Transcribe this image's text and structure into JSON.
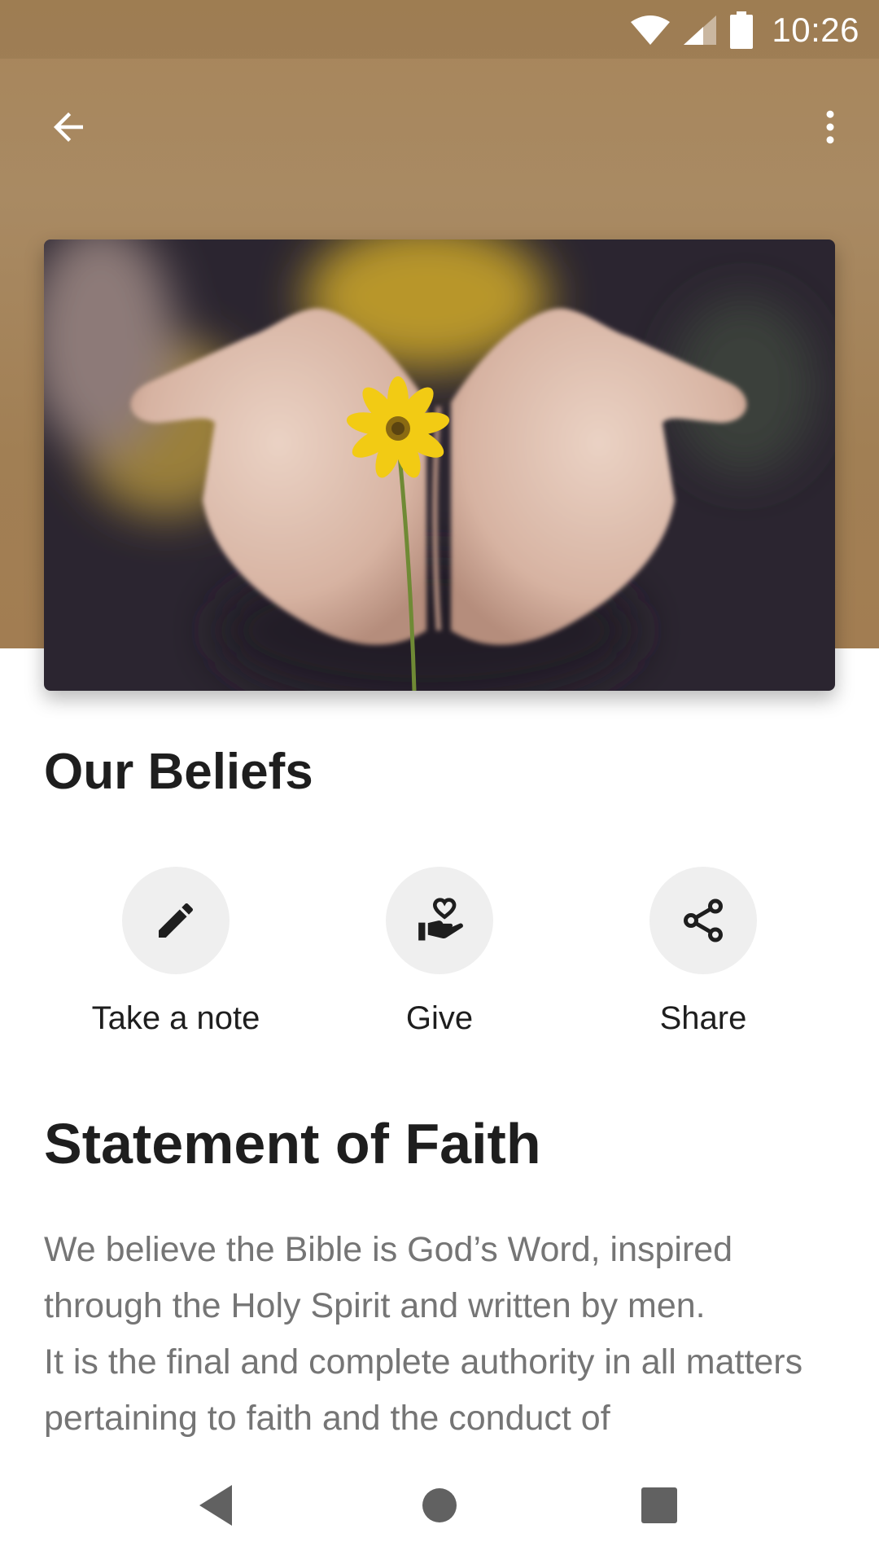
{
  "status_bar": {
    "time": "10:26"
  },
  "app_bar": {
    "back_icon": "arrow-back-icon",
    "menu_icon": "more-vert-icon"
  },
  "hero": {
    "image": "hands-holding-yellow-flower"
  },
  "page": {
    "title": "Our Beliefs"
  },
  "actions": [
    {
      "label": "Take a note",
      "icon": "pencil-icon"
    },
    {
      "label": "Give",
      "icon": "hand-heart-icon"
    },
    {
      "label": "Share",
      "icon": "share-icon"
    }
  ],
  "section": {
    "title": "Statement of Faith",
    "paragraphs": [
      "We believe the Bible is God’s Word, inspired through the Holy Spirit and written by men.",
      "It is the final and complete authority in all matters pertaining to faith and the conduct of"
    ]
  },
  "nav_bar": {
    "back": "nav-back-icon",
    "home": "nav-home-icon",
    "recents": "nav-recents-icon"
  },
  "colors": {
    "hero_bg": "#a7855a",
    "text_primary": "#1e1e1e",
    "text_body": "#757575",
    "action_circle": "#efefef"
  }
}
